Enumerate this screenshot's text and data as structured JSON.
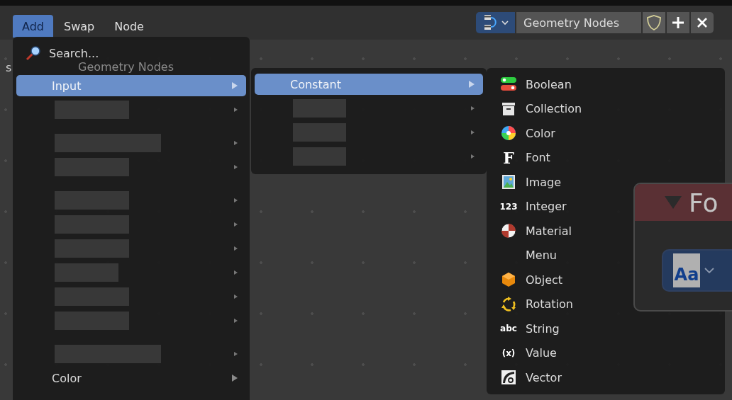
{
  "header": {
    "menus": [
      {
        "label": "Add",
        "selected": true
      },
      {
        "label": "Swap",
        "selected": false
      },
      {
        "label": "Node",
        "selected": false
      }
    ],
    "node_tree": {
      "name": "Geometry Nodes",
      "fake_user": true
    }
  },
  "editor": {
    "breadcrumb_partial": "s",
    "breadcrumb": "Geometry Nodes",
    "node": {
      "title": "Fo",
      "expanded": true,
      "font_icon_text": "Aa"
    }
  },
  "add_menu": {
    "items": [
      {
        "kind": "search",
        "label": "Search..."
      },
      {
        "kind": "submenu",
        "label": "Input",
        "selected": true
      },
      {
        "kind": "hidden"
      },
      {
        "kind": "separator"
      },
      {
        "kind": "hidden"
      },
      {
        "kind": "hidden"
      },
      {
        "kind": "separator"
      },
      {
        "kind": "hidden"
      },
      {
        "kind": "hidden"
      },
      {
        "kind": "hidden"
      },
      {
        "kind": "hidden"
      },
      {
        "kind": "hidden"
      },
      {
        "kind": "hidden"
      },
      {
        "kind": "separator"
      },
      {
        "kind": "hidden"
      },
      {
        "kind": "submenu",
        "label": "Color",
        "selected": false
      }
    ]
  },
  "input_menu": {
    "items": [
      {
        "kind": "submenu",
        "label": "Constant",
        "selected": true
      },
      {
        "kind": "hidden"
      },
      {
        "kind": "hidden"
      },
      {
        "kind": "hidden"
      }
    ]
  },
  "constant_menu": {
    "items": [
      {
        "kind": "boolean",
        "label": "Boolean"
      },
      {
        "kind": "collection",
        "label": "Collection"
      },
      {
        "kind": "color",
        "label": "Color"
      },
      {
        "kind": "font",
        "label": "Font",
        "glyph": "F"
      },
      {
        "kind": "image",
        "label": "Image"
      },
      {
        "kind": "integer",
        "label": "Integer",
        "glyph": "123"
      },
      {
        "kind": "material",
        "label": "Material"
      },
      {
        "kind": "menu",
        "label": "Menu"
      },
      {
        "kind": "object",
        "label": "Object"
      },
      {
        "kind": "rotation",
        "label": "Rotation"
      },
      {
        "kind": "string",
        "label": "String",
        "glyph": "abc"
      },
      {
        "kind": "value",
        "label": "Value",
        "glyph": "(x)"
      },
      {
        "kind": "vector",
        "label": "Vector"
      }
    ]
  }
}
